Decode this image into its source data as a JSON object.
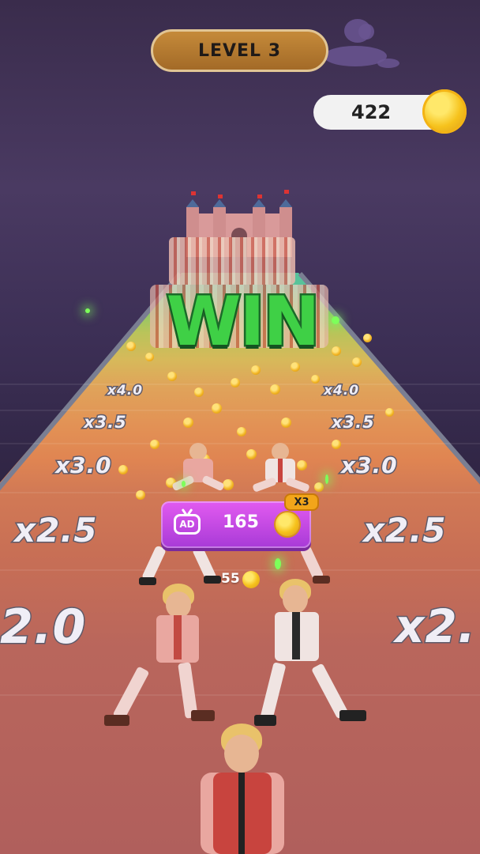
{
  "hud": {
    "level_label": "LEVEL 3",
    "coin_count": "422"
  },
  "banner": {
    "title": "WIN"
  },
  "multipliers": [
    "x4.0",
    "x4.0",
    "x3.5",
    "x3.5",
    "x3.0",
    "x3.0",
    "x2.5",
    "x2.5",
    "2.0",
    "x2."
  ],
  "reward": {
    "ad_label": "AD",
    "ad_value": "165",
    "bonus_badge": "X3",
    "base_value": "55"
  },
  "colors": {
    "win_green": "#3fd046",
    "ad_button": "#c24ae4",
    "level_pill": "#b7782f",
    "coin_gold": "#f6c21c"
  },
  "icons": [
    "coin-icon",
    "tv-ad-icon"
  ]
}
